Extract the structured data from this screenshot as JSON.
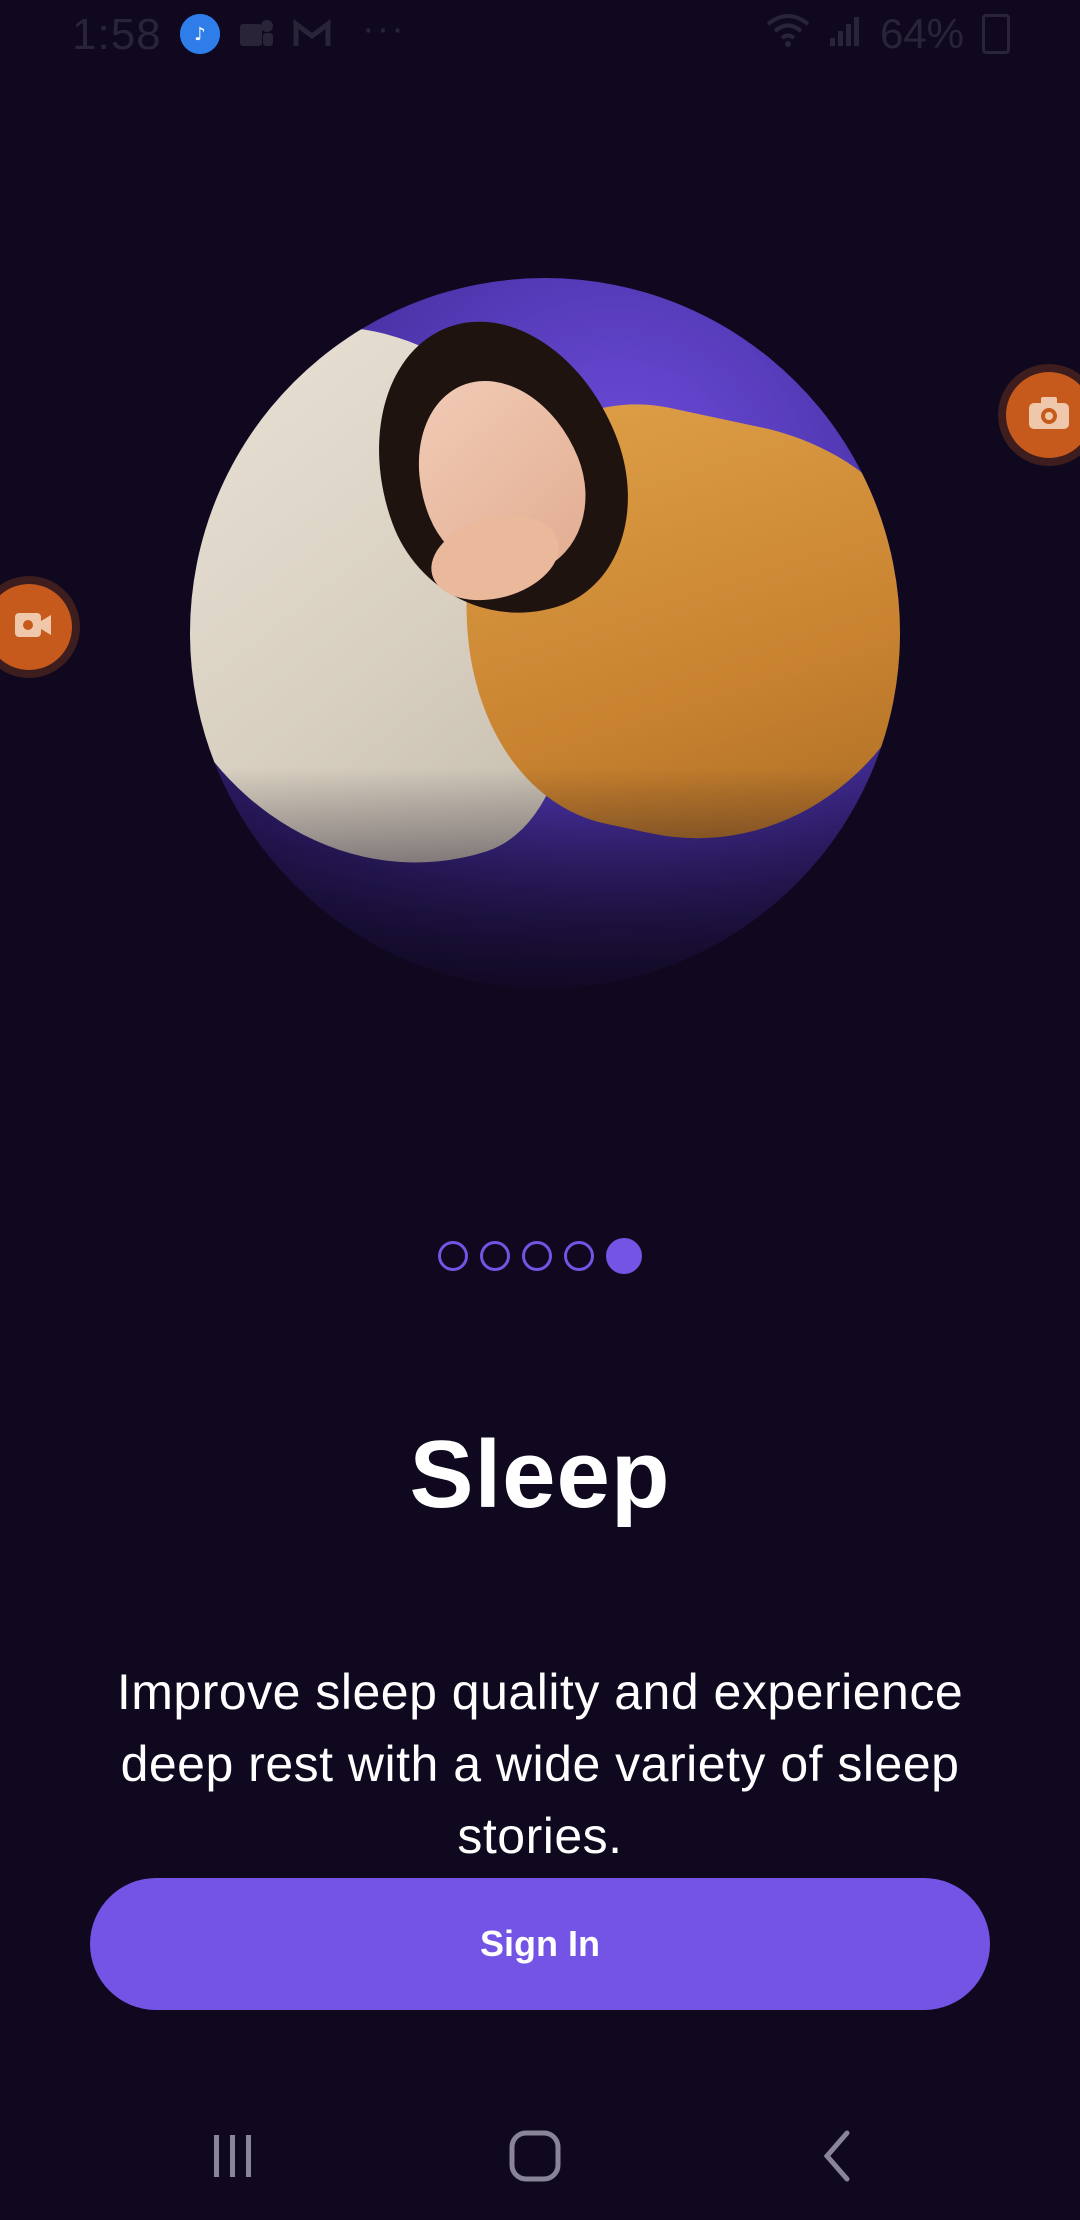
{
  "status_bar": {
    "time": "1:58",
    "dots": "···",
    "battery_percent": "64%",
    "icons": [
      "music-app-icon",
      "teams-icon",
      "gmail-icon",
      "wifi-icon",
      "signal-icon",
      "battery-icon"
    ]
  },
  "floating_bubbles": {
    "camera_icon": "camera-icon",
    "video_icon": "video-camera-icon",
    "color": "#c65a1c"
  },
  "onboarding": {
    "pages_total": 5,
    "current_page": 5,
    "title": "Sleep",
    "description": "Improve sleep quality and experience deep rest with a wide variety of sleep stories.",
    "sign_in_label": "Sign In"
  },
  "colors": {
    "background": "#0f081e",
    "accent": "#7354e4",
    "text": "#ffffff"
  },
  "nav_bar": {
    "icons": [
      "recents-icon",
      "home-icon",
      "back-icon"
    ]
  }
}
